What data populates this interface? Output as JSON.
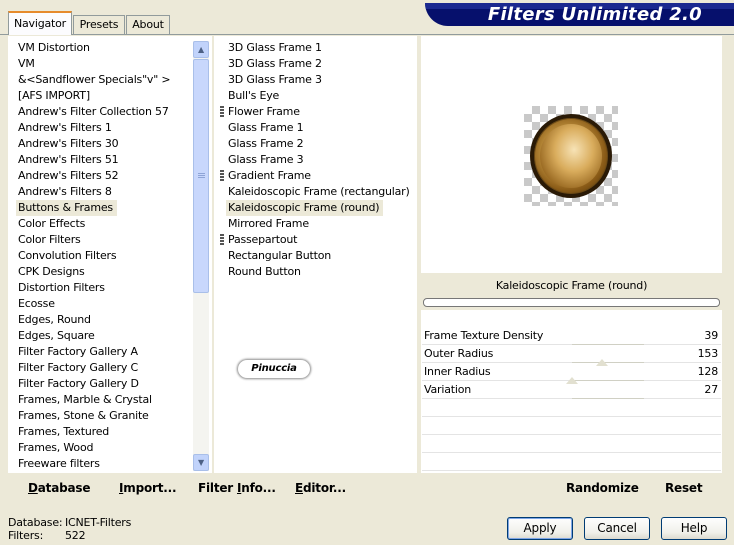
{
  "tabs": [
    "Navigator",
    "Presets",
    "About"
  ],
  "banner_title": "Filters Unlimited 2.0",
  "categories": [
    "VM Distortion",
    "VM",
    "&<Sandflower Specials\"v\" >",
    "[AFS IMPORT]",
    "Andrew's Filter Collection 57",
    "Andrew's Filters 1",
    "Andrew's Filters 30",
    "Andrew's Filters 51",
    "Andrew's Filters 52",
    "Andrew's Filters 8",
    "Buttons & Frames",
    "Color Effects",
    "Color Filters",
    "Convolution Filters",
    "CPK Designs",
    "Distortion Filters",
    "Ecosse",
    "Edges, Round",
    "Edges, Square",
    "Filter Factory Gallery A",
    "Filter Factory Gallery C",
    "Filter Factory Gallery D",
    "Frames, Marble & Crystal",
    "Frames, Stone & Granite",
    "Frames, Textured",
    "Frames, Wood",
    "Freeware filters"
  ],
  "selected_category": "Buttons & Frames",
  "filters": [
    "3D Glass Frame 1",
    "3D Glass Frame 2",
    "3D Glass Frame 3",
    "Bull's Eye",
    "Flower Frame",
    "Glass Frame 1",
    "Glass Frame 2",
    "Glass Frame 3",
    "Gradient Frame",
    "Kaleidoscopic Frame (rectangular)",
    "Kaleidoscopic Frame (round)",
    "Mirrored Frame",
    "Passepartout",
    "Rectangular Button",
    "Round Button"
  ],
  "filters_marked": [
    "Flower Frame",
    "Gradient Frame",
    "Passepartout"
  ],
  "selected_filter": "Kaleidoscopic Frame (round)",
  "watermark": "Pinuccia",
  "preview": {
    "filter_name": "Kaleidoscopic Frame (round)"
  },
  "params": [
    {
      "name": "Frame Texture Density",
      "value": "39"
    },
    {
      "name": "Outer Radius",
      "value": "153"
    },
    {
      "name": "Inner Radius",
      "value": "128"
    },
    {
      "name": "Variation",
      "value": "27"
    }
  ],
  "left_buttons": {
    "database": "Database",
    "import": "Import...",
    "filter_info": "Filter Info...",
    "editor": "Editor..."
  },
  "right_buttons": {
    "randomize": "Randomize",
    "reset": "Reset"
  },
  "status": {
    "database_label": "Database:",
    "database_value": "ICNET-Filters",
    "filters_label": "Filters:",
    "filters_value": "522"
  },
  "dialog_buttons": {
    "apply": "Apply",
    "cancel": "Cancel",
    "help": "Help"
  }
}
